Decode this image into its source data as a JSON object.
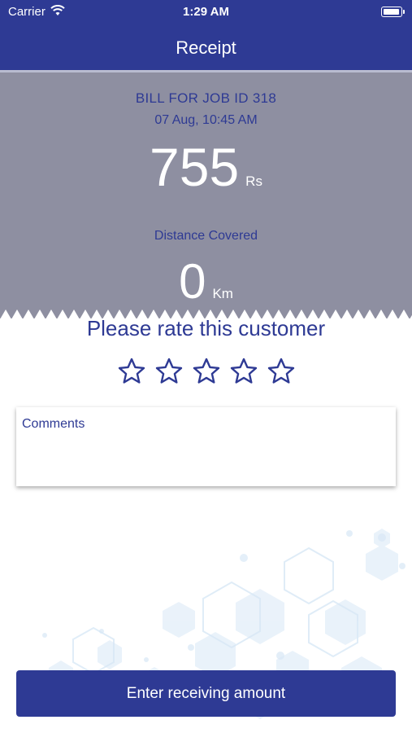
{
  "status_bar": {
    "carrier": "Carrier",
    "time": "1:29 AM"
  },
  "header": {
    "title": "Receipt"
  },
  "receipt": {
    "bill_label": "BILL FOR JOB ID 318",
    "date": "07 Aug, 10:45 AM",
    "amount": "755",
    "amount_unit": "Rs",
    "distance_label": "Distance Covered",
    "distance": "0",
    "distance_unit": "Km"
  },
  "rating": {
    "prompt": "Please rate this customer",
    "max_stars": 5,
    "current": 0
  },
  "comments": {
    "label": "Comments"
  },
  "action": {
    "label": "Enter receiving amount"
  },
  "colors": {
    "primary": "#2e3a94",
    "card": "#8e8fa1",
    "background": "#ffffff"
  },
  "icons": {
    "wifi": "wifi-icon",
    "battery": "battery-icon",
    "star": "star-outline-icon"
  }
}
